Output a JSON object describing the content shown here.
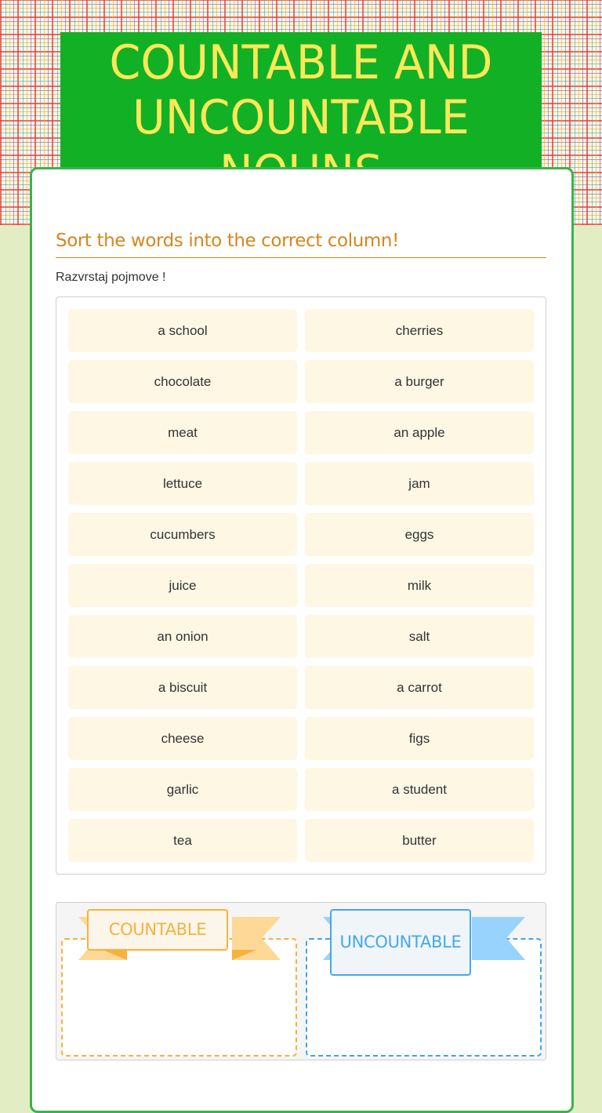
{
  "header": {
    "title": "COUNTABLE AND UNCOUNTABLE NOUNS"
  },
  "colors": {
    "title_bg": "#12b125",
    "title_text": "#fbe85a",
    "card_border": "#3cb34a",
    "instruction_color": "#d6861c",
    "tile_bg": "#fdf7e4",
    "countable_accent": "#f8b13c",
    "uncountable_accent": "#45a8ec",
    "page_bg": "#e2edc4"
  },
  "instructions": {
    "heading": "Sort the words into the correct column!",
    "subtext": "Razvrstaj pojmove !"
  },
  "word_bank": {
    "words": [
      "a school",
      "cherries",
      "chocolate",
      "a burger",
      "meat",
      "an apple",
      "lettuce",
      "jam",
      "cucumbers",
      "eggs",
      "juice",
      "milk",
      "an onion",
      "salt",
      "a biscuit",
      "a carrot",
      "cheese",
      "figs",
      "garlic",
      "a student",
      "tea",
      "butter"
    ]
  },
  "categories": [
    {
      "label": "COUNTABLE",
      "icon": "ribbon-banner-icon"
    },
    {
      "label": "UNCOUNTABLE",
      "icon": "ribbon-banner-icon"
    }
  ]
}
